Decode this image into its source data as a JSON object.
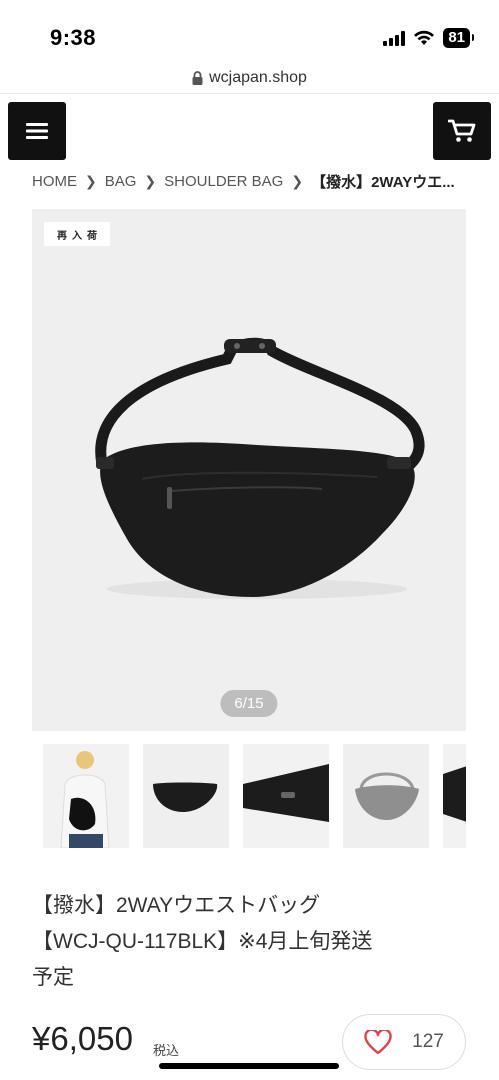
{
  "status_bar": {
    "time": "9:38",
    "battery": "81"
  },
  "url_bar": {
    "domain": "wcjapan.shop"
  },
  "header": {
    "menu_icon": "hamburger-menu-icon",
    "cart_icon": "shopping-cart-icon"
  },
  "breadcrumb": {
    "items": [
      "HOME",
      "BAG",
      "SHOULDER BAG"
    ],
    "current": "【撥水】2WAYウエ..."
  },
  "gallery": {
    "badge": "再入荷",
    "counter": "6/15",
    "thumbnail_count_visible": 5
  },
  "product": {
    "title_line1": "【撥水】2WAYウエストバッグ",
    "title_line2": "【WCJ-QU-117BLK】※4月上旬発送",
    "title_line3": "予定",
    "price": "¥6,050",
    "tax_label": "税込",
    "favorite_count": "127"
  }
}
